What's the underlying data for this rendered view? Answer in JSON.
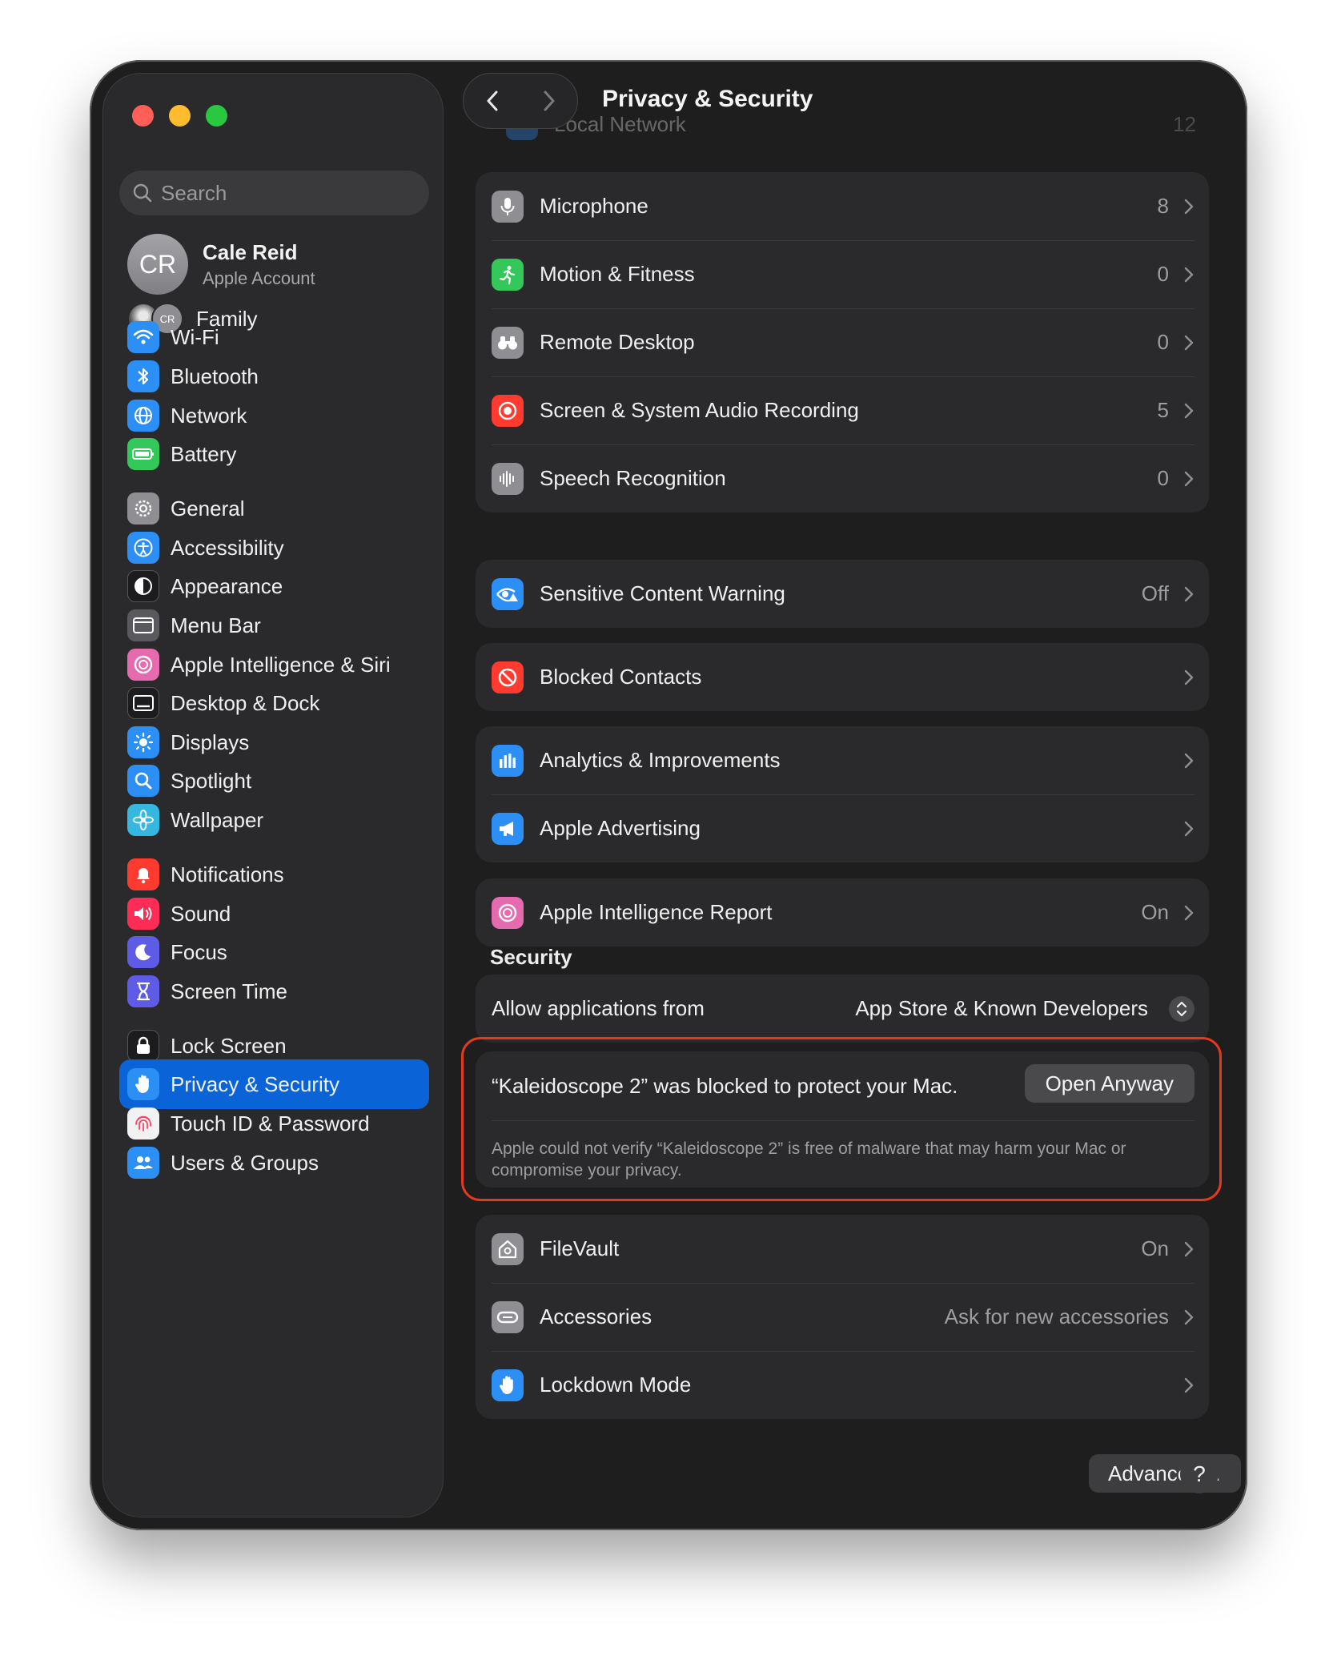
{
  "window": {
    "title": "Privacy & Security"
  },
  "sidebar": {
    "search_placeholder": "Search",
    "account": {
      "initials": "CR",
      "name": "Cale Reid",
      "subtitle": "Apple Account"
    },
    "family": {
      "badge": "CR",
      "label": "Family"
    },
    "items": [
      {
        "label": "Wi-Fi",
        "icon": "wifi-icon",
        "color": "#2b8ff5"
      },
      {
        "label": "Bluetooth",
        "icon": "bluetooth-icon",
        "color": "#2b8ff5"
      },
      {
        "label": "Network",
        "icon": "globe-icon",
        "color": "#2b8ff5"
      },
      {
        "label": "Battery",
        "icon": "battery-icon",
        "color": "#34c759"
      },
      {
        "label": "General",
        "icon": "gear-icon",
        "color": "#8e8e93"
      },
      {
        "label": "Accessibility",
        "icon": "accessibility-icon",
        "color": "#2b8ff5"
      },
      {
        "label": "Appearance",
        "icon": "appearance-icon",
        "color": "#1c1c1e"
      },
      {
        "label": "Menu Bar",
        "icon": "menu-bar-icon",
        "color": "#5a5a5e"
      },
      {
        "label": "Apple Intelligence & Siri",
        "icon": "apple-intelligence-icon",
        "color": "#e66ab0"
      },
      {
        "label": "Desktop & Dock",
        "icon": "dock-icon",
        "color": "#1c1c1e"
      },
      {
        "label": "Displays",
        "icon": "sun-icon",
        "color": "#2b8ff5"
      },
      {
        "label": "Spotlight",
        "icon": "magnifier-icon",
        "color": "#2b8ff5"
      },
      {
        "label": "Wallpaper",
        "icon": "flower-icon",
        "color": "#35b8e0"
      },
      {
        "label": "Notifications",
        "icon": "bell-icon",
        "color": "#ff3b30"
      },
      {
        "label": "Sound",
        "icon": "speaker-icon",
        "color": "#ff2d55"
      },
      {
        "label": "Focus",
        "icon": "moon-icon",
        "color": "#5e5ce6"
      },
      {
        "label": "Screen Time",
        "icon": "hourglass-icon",
        "color": "#5e5ce6"
      },
      {
        "label": "Lock Screen",
        "icon": "lock-icon",
        "color": "#1c1c1e"
      },
      {
        "label": "Privacy & Security",
        "icon": "hand-icon",
        "color": "#2b8ff5"
      },
      {
        "label": "Touch ID & Password",
        "icon": "fingerprint-icon",
        "color": "#f2f2f2"
      },
      {
        "label": "Users & Groups",
        "icon": "users-icon",
        "color": "#2b8ff5"
      }
    ]
  },
  "main": {
    "ghost_row": {
      "label": "Local Network",
      "value": "12"
    },
    "privacy_rows": [
      {
        "label": "Microphone",
        "value": "8",
        "icon": "microphone-icon",
        "color": "#8e8e93"
      },
      {
        "label": "Motion & Fitness",
        "value": "0",
        "icon": "running-figure-icon",
        "color": "#34c759"
      },
      {
        "label": "Remote Desktop",
        "value": "0",
        "icon": "binoculars-icon",
        "color": "#8e8e93"
      },
      {
        "label": "Screen & System Audio Recording",
        "value": "5",
        "icon": "record-icon",
        "color": "#ff3b30"
      },
      {
        "label": "Speech Recognition",
        "value": "0",
        "icon": "waveform-icon",
        "color": "#8e8e93"
      }
    ],
    "sensitive": {
      "label": "Sensitive Content Warning",
      "value": "Off",
      "icon": "eye-warning-icon",
      "color": "#2b8ff5"
    },
    "blocked_contacts": {
      "label": "Blocked Contacts",
      "value": "",
      "icon": "no-entry-icon",
      "color": "#ff3b30"
    },
    "analytics_rows": [
      {
        "label": "Analytics & Improvements",
        "value": "",
        "icon": "bar-chart-icon",
        "color": "#2b8ff5"
      },
      {
        "label": "Apple Advertising",
        "value": "",
        "icon": "megaphone-icon",
        "color": "#2b8ff5"
      }
    ],
    "ai_report": {
      "label": "Apple Intelligence Report",
      "value": "On",
      "icon": "apple-intelligence-icon",
      "color": "#e66ab0"
    },
    "security": {
      "title": "Security",
      "allow_label": "Allow applications from",
      "allow_value": "App Store & Known Developers",
      "blocked_message": "“Kaleidoscope 2” was blocked to protect your Mac.",
      "open_anyway": "Open Anyway",
      "blocked_detail": "Apple could not verify “Kaleidoscope 2” is free of malware that may harm your Mac or compromise your privacy."
    },
    "security_rows": [
      {
        "label": "FileVault",
        "value": "On",
        "icon": "filevault-icon",
        "color": "#8e8e93"
      },
      {
        "label": "Accessories",
        "value": "Ask for new accessories",
        "icon": "accessory-icon",
        "color": "#8e8e93"
      },
      {
        "label": "Lockdown Mode",
        "value": "",
        "icon": "hand-icon",
        "color": "#2b8ff5"
      }
    ],
    "advanced_label": "Advanced…",
    "help_label": "?"
  },
  "colors": {
    "accent": "#0a64d8",
    "highlight": "#e23a1c"
  }
}
